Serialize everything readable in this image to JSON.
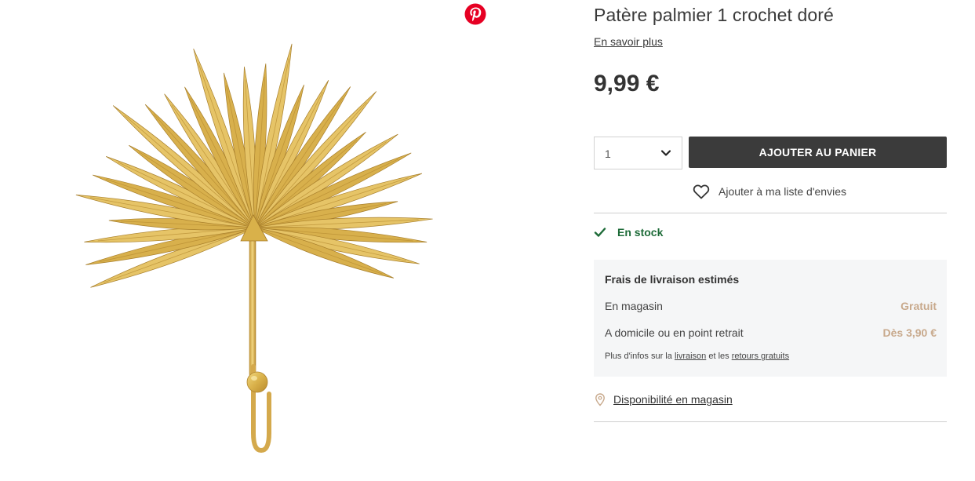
{
  "product": {
    "title": "Patère palmier 1 crochet doré",
    "learn_more": "En savoir plus",
    "price": "9,99 €",
    "image_icon": "gold-palm-leaf-hook-image"
  },
  "share": {
    "pinterest_icon": "pinterest-icon",
    "brand_color": "#e60023"
  },
  "purchase": {
    "quantity": "1",
    "add_to_cart": "AJOUTER AU PANIER",
    "wishlist": "Ajouter à ma liste d'envies"
  },
  "stock": {
    "label": "En stock",
    "color": "#1d6b38"
  },
  "shipping": {
    "title": "Frais de livraison estimés",
    "rows": [
      {
        "label": "En magasin",
        "value": "Gratuit"
      },
      {
        "label": "A domicile ou en point retrait",
        "value": "Dès 3,90 €"
      }
    ],
    "note_prefix": "Plus d'infos sur la",
    "note_link1": "livraison",
    "note_middle": "et les",
    "note_link2": "retours gratuits",
    "accent_color": "#c8a98c"
  },
  "store": {
    "label": "Disponibilité en magasin"
  },
  "colors": {
    "button_bg": "#3b3b3b",
    "panel_bg": "#f5f6f7"
  }
}
